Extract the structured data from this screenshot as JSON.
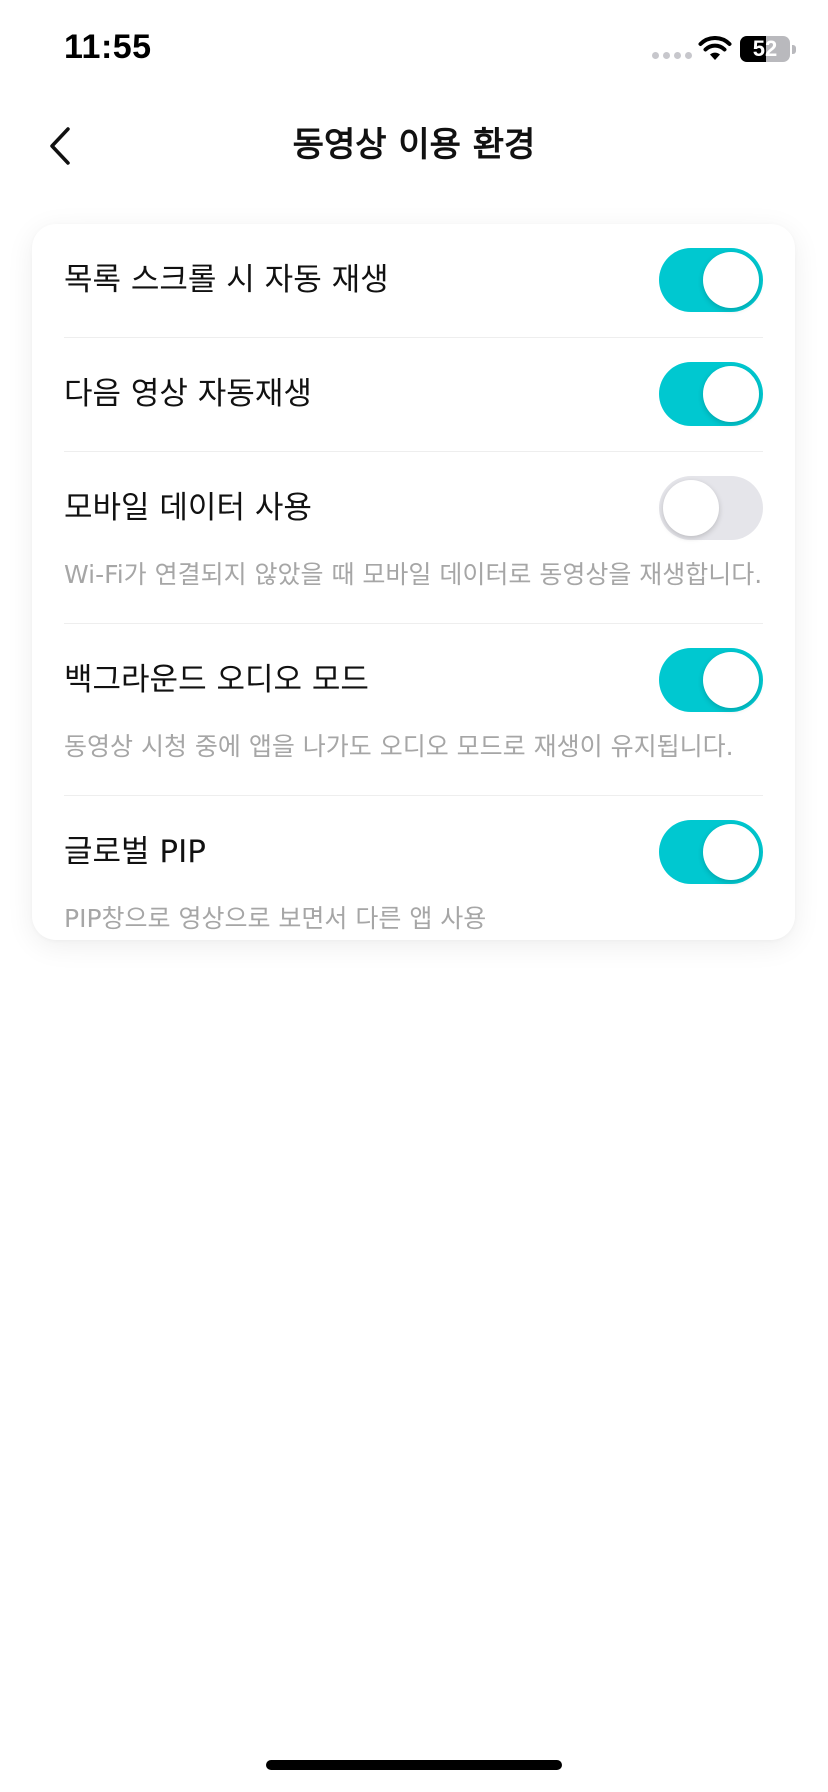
{
  "status_bar": {
    "time": "11:55",
    "battery": "52",
    "battery_fraction": 0.52
  },
  "header": {
    "back_icon": "chevron-left-icon",
    "title": "동영상 이용 환경"
  },
  "settings": [
    {
      "label": "목록 스크롤 시 자동 재생",
      "enabled": true,
      "description": ""
    },
    {
      "label": "다음 영상 자동재생",
      "enabled": true,
      "description": ""
    },
    {
      "label": "모바일 데이터 사용",
      "enabled": false,
      "description": "Wi-Fi가 연결되지 않았을 때 모바일 데이터로 동영상을 재생합니다."
    },
    {
      "label": "백그라운드 오디오 모드",
      "enabled": true,
      "description": "동영상 시청 중에 앱을 나가도 오디오 모드로 재생이 유지됩니다."
    },
    {
      "label": "글로벌 PIP",
      "enabled": true,
      "description": "PIP창으로 영상으로 보면서 다른 앱 사용"
    }
  ],
  "colors": {
    "toggle_on": "#00c8d0",
    "toggle_off": "#e5e5ea",
    "description_text": "#a6a6a6"
  }
}
